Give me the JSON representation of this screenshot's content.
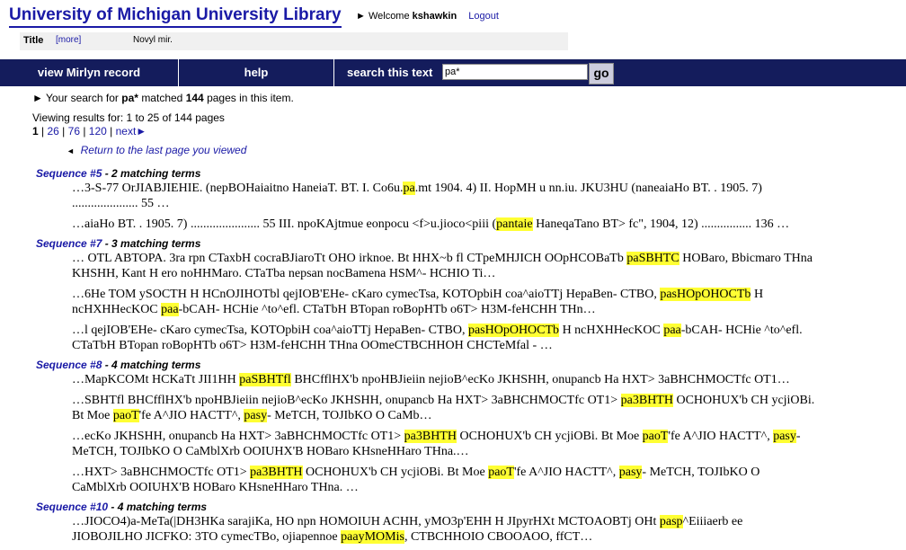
{
  "header": {
    "logo": "University of Michigan University Library",
    "welcome_prefix": "► Welcome",
    "username": "kshawkin",
    "logout": "Logout"
  },
  "meta": {
    "title_label": "Title",
    "more_link": "[more]",
    "title_value": "Novyl mir."
  },
  "nav": {
    "view_record": "view Mirlyn record",
    "help": "help",
    "search_label": "search this text",
    "search_value": "pa*",
    "go": "go"
  },
  "summary": {
    "prefix": "► Your search for",
    "term": "pa*",
    "mid": "matched",
    "count": "144",
    "suffix": "pages in this item."
  },
  "viewing": "Viewing results for: 1 to 25 of 144 pages",
  "pager": {
    "current": "1",
    "links": [
      "26",
      "76",
      "120",
      "next►"
    ]
  },
  "return_link": "Return to the last page you viewed",
  "results": [
    {
      "seq_link": "Sequence #5",
      "matches": " - 2 matching terms",
      "snippets": [
        [
          {
            "t": "…3-S-77 OrJIABJIEHIE. (nepBOHaiaitno HaneiaT. BT. I. Co6u."
          },
          {
            "t": "pa",
            "h": true
          },
          {
            "t": ".mt 1904. 4) II. HopMH u nn.iu. JKU3HU (naneaiaHo BT. . 1905. 7) ..................... 55 …"
          }
        ],
        [
          {
            "t": "…aiaHo BT. . 1905. 7) ...................... 55 III. npoKAjtmue eonpocu <f>u.jioco<piii ("
          },
          {
            "t": "pantaie",
            "h": true
          },
          {
            "t": " HaneqaTano BT> fc\", 1904, 12) ................ 136 …"
          }
        ]
      ]
    },
    {
      "seq_link": "Sequence #7",
      "matches": " - 3 matching terms",
      "snippets": [
        [
          {
            "t": "… OTL ABTOPA. 3ra rpn CTaxbH cocraBJiaroTt OHO irknoe. Bt HHX~b fl CTpeMHJICH OOpHCOBaTb "
          },
          {
            "t": "paSBHTC",
            "h": true
          },
          {
            "t": " HOBaro, Bbicmaro THna KHSHH, Kant H ero noHHMaro. CTaTba nepsan nocBamena HSM^- HCHIO Ti…"
          }
        ],
        [
          {
            "t": "…6He TOM ySOCTH H HCnOJIHOTbl qejIOB'EHe- cKaro cymecTsa, KOTOpbiH coa^aioTTj HepaBen- CTBO, "
          },
          {
            "t": "pasHOpOHOCTb",
            "h": true
          },
          {
            "t": " H ncHXHHecKOC "
          },
          {
            "t": "paa",
            "h": true
          },
          {
            "t": "-bCAH- HCHie ^to^efl. CTaTbH BTopan roBopHTb o6T> H3M-feHCHH THn…"
          }
        ],
        [
          {
            "t": "…l qejIOB'EHe- cKaro cymecTsa, KOTOpbiH coa^aioTTj HepaBen- CTBO, "
          },
          {
            "t": "pasHOpOHOCTb",
            "h": true
          },
          {
            "t": " H ncHXHHecKOC "
          },
          {
            "t": "paa",
            "h": true
          },
          {
            "t": "-bCAH- HCHie ^to^efl. CTaTbH BTopan roBopHTb o6T> H3M-feHCHH THna OOmeCTBCHHOH CHCTeMfal - …"
          }
        ]
      ]
    },
    {
      "seq_link": "Sequence #8",
      "matches": " - 4 matching terms",
      "snippets": [
        [
          {
            "t": "…MapKCOMt HCKaTt JII1HH "
          },
          {
            "t": "paSBHTfl",
            "h": true
          },
          {
            "t": " BHCfflHX'b npoHBJieiin nejioB^ecKo JKHSHH, onupancb Ha HXT> 3aBHCHMOCTfc OT1…"
          }
        ],
        [
          {
            "t": "…SBHTfl BHCfflHX'b npoHBJieiin nejioB^ecKo JKHSHH, onupancb Ha HXT> 3aBHCHMOCTfc OT1> "
          },
          {
            "t": "pa3BHTH",
            "h": true
          },
          {
            "t": " OCHOHUX'b CH ycjiOBi. Bt Moe "
          },
          {
            "t": "paoT",
            "h": true
          },
          {
            "t": "'fe A^JIO HACTT^, "
          },
          {
            "t": "pasy",
            "h": true
          },
          {
            "t": "- MeTCH, TOJIbKO O CaMb…"
          }
        ],
        [
          {
            "t": "…ecKo JKHSHH, onupancb Ha HXT> 3aBHCHMOCTfc OT1> "
          },
          {
            "t": "pa3BHTH",
            "h": true
          },
          {
            "t": " OCHOHUX'b CH ycjiOBi. Bt Moe "
          },
          {
            "t": "paoT",
            "h": true
          },
          {
            "t": "'fe A^JIO HACTT^, "
          },
          {
            "t": "pasy",
            "h": true
          },
          {
            "t": "- MeTCH, TOJIbKO O CaMblXrb OOIUHX'B HOBaro KHsneHHaro THna.…"
          }
        ],
        [
          {
            "t": "…HXT> 3aBHCHMOCTfc OT1> "
          },
          {
            "t": "pa3BHTH",
            "h": true
          },
          {
            "t": " OCHOHUX'b CH ycjiOBi. Bt Moe "
          },
          {
            "t": "paoT",
            "h": true
          },
          {
            "t": "'fe A^JIO HACTT^, "
          },
          {
            "t": "pasy",
            "h": true
          },
          {
            "t": "- MeTCH, TOJIbKO O CaMblXrb OOIUHX'B HOBaro KHsneHHaro THna. …"
          }
        ]
      ]
    },
    {
      "seq_link": "Sequence #10",
      "matches": " - 4 matching terms",
      "snippets": [
        [
          {
            "t": "…JIOCO4)a-MeTa(|DH3HKa sarajiKa, HO npn HOMOIUH ACHH, yMO3p'EHH H JIpyrHXt MCTOAOBTj OHt "
          },
          {
            "t": "pasp",
            "h": true
          },
          {
            "t": "^Eiiiaerb ee JIOBOJILHO JICFKO: 3TO cymecTBo, ojiapennoe "
          },
          {
            "t": "paayMOMis",
            "h": true
          },
          {
            "t": ", CTBCHHOIO CBOOAOO, ffCT…"
          }
        ]
      ]
    }
  ]
}
